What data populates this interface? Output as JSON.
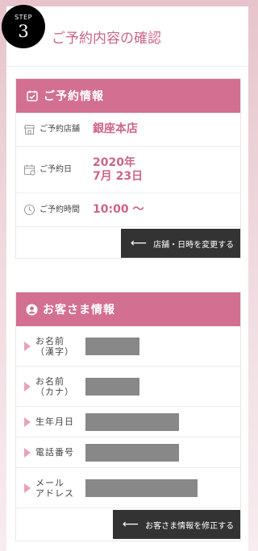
{
  "step": {
    "label": "STEP",
    "number": "3"
  },
  "title": "ご予約内容の確認",
  "reservation": {
    "heading": "ご予約情報",
    "store_label": "ご予約店舗",
    "store_value": "銀座本店",
    "date_label": "ご予約日",
    "date_line1": "2020年",
    "date_line2": "7月 23日",
    "time_label": "ご予約時間",
    "time_value": "10:00 〜",
    "change_button": "店舗・日時を変更する"
  },
  "customer": {
    "heading": "お客さま情報",
    "name_kanji_label_1": "お名前",
    "name_kanji_label_2": "（漢字）",
    "name_kana_label_1": "お名前",
    "name_kana_label_2": "（カナ）",
    "birthday_label": "生年月日",
    "phone_label": "電話番号",
    "email_label_1": "メール",
    "email_label_2": "アドレス",
    "edit_button": "お客さま情報を修正する"
  },
  "colors": {
    "accent": "#d36f91",
    "accent_text": "#cc6585",
    "button": "#333333"
  }
}
